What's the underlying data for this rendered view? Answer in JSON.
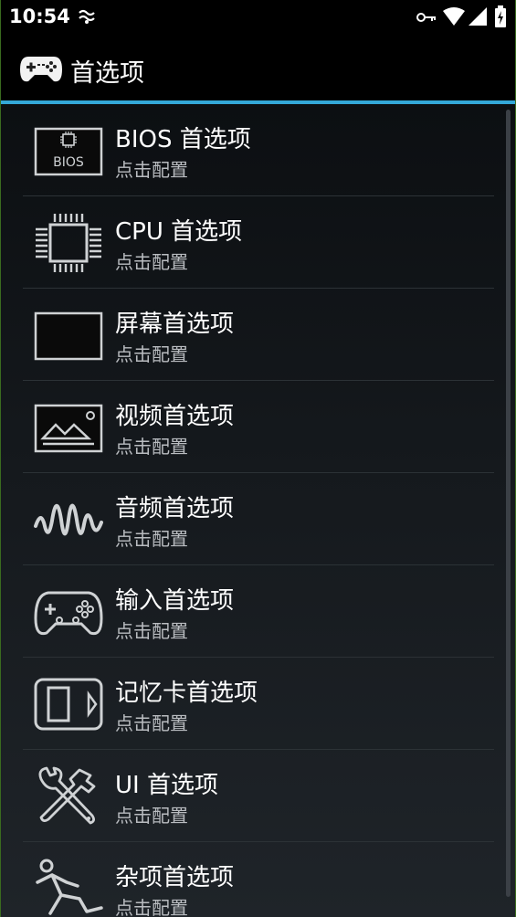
{
  "status_bar": {
    "time": "10:54",
    "icons": [
      "notification-icon",
      "key-icon",
      "wifi-icon",
      "signal-icon",
      "battery-charging-icon"
    ]
  },
  "app_bar": {
    "title": "首选项",
    "icon": "gamepad-icon",
    "accent_color": "#34a8d8"
  },
  "preferences": [
    {
      "title": "BIOS 首选项",
      "subtitle": "点击配置",
      "icon": "bios-chip-icon",
      "icon_label": "BIOS"
    },
    {
      "title": "CPU 首选项",
      "subtitle": "点击配置",
      "icon": "cpu-icon"
    },
    {
      "title": "屏幕首选项",
      "subtitle": "点击配置",
      "icon": "screen-icon"
    },
    {
      "title": "视频首选项",
      "subtitle": "点击配置",
      "icon": "video-picture-icon"
    },
    {
      "title": "音频首选项",
      "subtitle": "点击配置",
      "icon": "audio-wave-icon"
    },
    {
      "title": "输入首选项",
      "subtitle": "点击配置",
      "icon": "controller-icon"
    },
    {
      "title": "记忆卡首选项",
      "subtitle": "点击配置",
      "icon": "memory-card-icon"
    },
    {
      "title": "UI 首选项",
      "subtitle": "点击配置",
      "icon": "tools-icon"
    },
    {
      "title": "杂项首选项",
      "subtitle": "点击配置",
      "icon": "running-man-icon"
    }
  ]
}
